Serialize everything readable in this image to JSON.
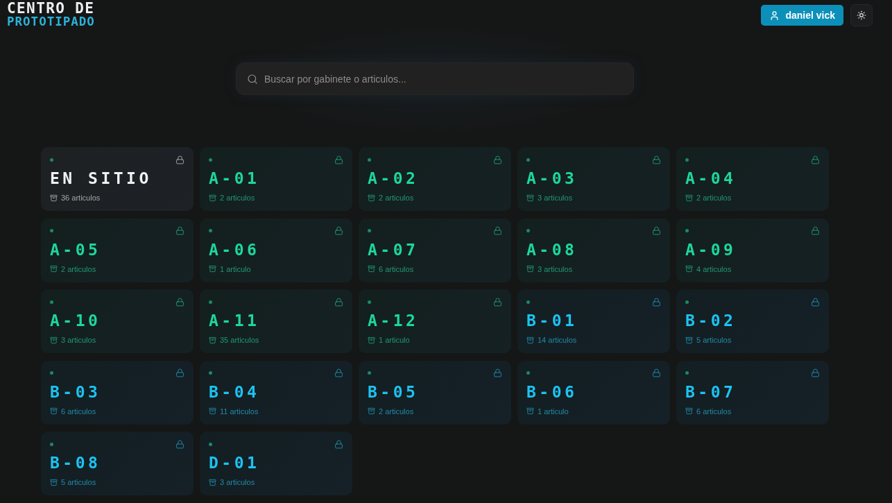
{
  "logo": {
    "line_1": "CENTRO DE",
    "line_2": "PROTOTIPADO"
  },
  "user_button": {
    "label": "daniel vick"
  },
  "search": {
    "placeholder": "Buscar por gabinete o articulos..."
  },
  "cabinets": [
    {
      "name": "EN SITIO",
      "count": "36 articulos",
      "color": "#f0f1f2",
      "locked": true
    },
    {
      "name": "A-01",
      "count": "2 articulos",
      "color": "#1dd79b",
      "locked": true
    },
    {
      "name": "A-02",
      "count": "2 articulos",
      "color": "#1dd79b",
      "locked": true
    },
    {
      "name": "A-03",
      "count": "3 articulos",
      "color": "#1dd79b",
      "locked": true
    },
    {
      "name": "A-04",
      "count": "2 articulos",
      "color": "#1dd79b",
      "locked": true
    },
    {
      "name": "A-05",
      "count": "2 articulos",
      "color": "#1dd79b",
      "locked": true
    },
    {
      "name": "A-06",
      "count": "1 articulo",
      "color": "#1dd79b",
      "locked": true
    },
    {
      "name": "A-07",
      "count": "6 articulos",
      "color": "#1dd79b",
      "locked": true
    },
    {
      "name": "A-08",
      "count": "3 articulos",
      "color": "#1dd79b",
      "locked": true
    },
    {
      "name": "A-09",
      "count": "4 articulos",
      "color": "#1dd79b",
      "locked": true
    },
    {
      "name": "A-10",
      "count": "3 articulos",
      "color": "#1dd79b",
      "locked": true
    },
    {
      "name": "A-11",
      "count": "35 articulos",
      "color": "#1dd79b",
      "locked": true
    },
    {
      "name": "A-12",
      "count": "1 articulo",
      "color": "#1dd79b",
      "locked": true
    },
    {
      "name": "B-01",
      "count": "14 articulos",
      "color": "#1cc3f1",
      "locked": true
    },
    {
      "name": "B-02",
      "count": "5 articulos",
      "color": "#1cc3f1",
      "locked": true
    },
    {
      "name": "B-03",
      "count": "6 articulos",
      "color": "#1cc3f1",
      "locked": true
    },
    {
      "name": "B-04",
      "count": "11 articulos",
      "color": "#1cc3f1",
      "locked": true
    },
    {
      "name": "B-05",
      "count": "2 articulos",
      "color": "#1cc3f1",
      "locked": true
    },
    {
      "name": "B-06",
      "count": "1 articulo",
      "color": "#1cc3f1",
      "locked": true
    },
    {
      "name": "B-07",
      "count": "6 articulos",
      "color": "#1cc3f1",
      "locked": true
    },
    {
      "name": "B-08",
      "count": "5 articulos",
      "color": "#1cc3f1",
      "locked": true
    },
    {
      "name": "D-01",
      "count": "3 articulos",
      "color": "#1cc3f1",
      "locked": true
    }
  ]
}
